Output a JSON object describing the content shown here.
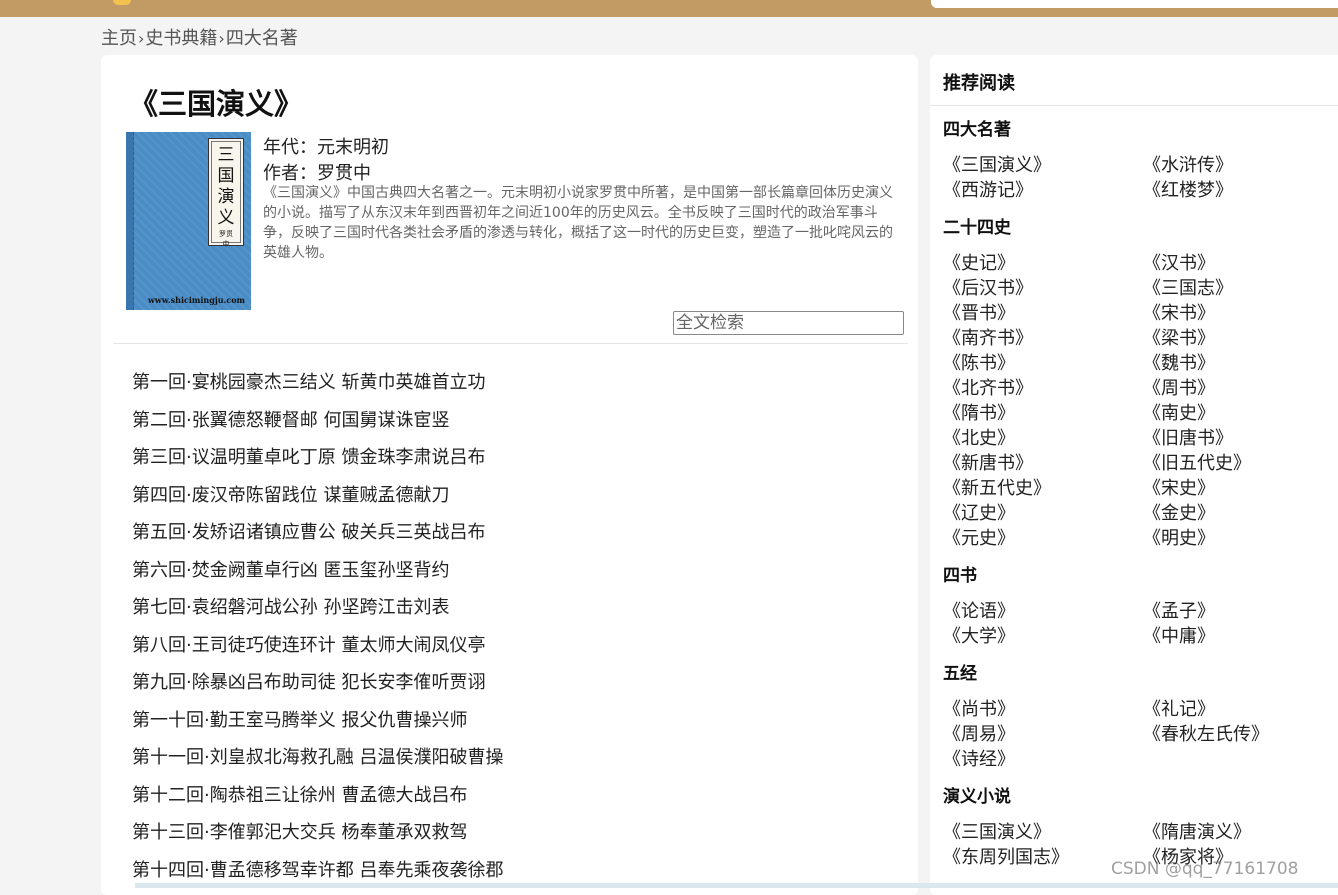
{
  "breadcrumb": {
    "home": "主页",
    "category": "史书典籍",
    "current": "四大名著",
    "separator": "›"
  },
  "book": {
    "title": "《三国演义》",
    "era_label": "年代：",
    "era": "元末明初",
    "author_label": "作者：",
    "author": "罗贯中",
    "description": "《三国演义》中国古典四大名著之一。元末明初小说家罗贯中所著，是中国第一部长篇章回体历史演义的小说。描写了从东汉末年到西晋初年之间近100年的历史风云。全书反映了三国时代的政治军事斗争，反映了三国时代各类社会矛盾的渗透与转化，概括了这一时代的历史巨变，塑造了一批叱咤风云的英雄人物。",
    "cover": {
      "title_vertical": "三国演义",
      "author_small": "罗贯中",
      "url": "www.shicimingju.com",
      "color": "#4a8dc6"
    }
  },
  "search": {
    "placeholder": "全文检索"
  },
  "chapters": [
    "第一回·宴桃园豪杰三结义 斩黄巾英雄首立功",
    "第二回·张翼德怒鞭督邮 何国舅谋诛宦竖",
    "第三回·议温明董卓叱丁原 馈金珠李肃说吕布",
    "第四回·废汉帝陈留践位 谋董贼孟德献刀",
    "第五回·发矫诏诸镇应曹公 破关兵三英战吕布",
    "第六回·焚金阙董卓行凶 匿玉玺孙坚背约",
    "第七回·袁绍磐河战公孙 孙坚跨江击刘表",
    "第八回·王司徒巧使连环计 董太师大闹凤仪亭",
    "第九回·除暴凶吕布助司徒 犯长安李傕听贾诩",
    "第一十回·勤王室马腾举义 报父仇曹操兴师",
    "第十一回·刘皇叔北海救孔融 吕温侯濮阳破曹操",
    "第十二回·陶恭祖三让徐州 曹孟德大战吕布",
    "第十三回·李傕郭汜大交兵 杨奉董承双救驾",
    "第十四回·曹孟德移驾幸许都 吕奉先乘夜袭徐郡"
  ],
  "sidebar": {
    "title": "推荐阅读",
    "sections": [
      {
        "heading": "四大名著",
        "items": [
          "《三国演义》",
          "《水浒传》",
          "《西游记》",
          "《红楼梦》"
        ]
      },
      {
        "heading": "二十四史",
        "items": [
          "《史记》",
          "《汉书》",
          "《后汉书》",
          "《三国志》",
          "《晋书》",
          "《宋书》",
          "《南齐书》",
          "《梁书》",
          "《陈书》",
          "《魏书》",
          "《北齐书》",
          "《周书》",
          "《隋书》",
          "《南史》",
          "《北史》",
          "《旧唐书》",
          "《新唐书》",
          "《旧五代史》",
          "《新五代史》",
          "《宋史》",
          "《辽史》",
          "《金史》",
          "《元史》",
          "《明史》"
        ]
      },
      {
        "heading": "四书",
        "items": [
          "《论语》",
          "《孟子》",
          "《大学》",
          "《中庸》"
        ]
      },
      {
        "heading": "五经",
        "items": [
          "《尚书》",
          "《礼记》",
          "《周易》",
          "《春秋左氏传》",
          "《诗经》"
        ]
      },
      {
        "heading": "演义小说",
        "items": [
          "《三国演义》",
          "《隋唐演义》",
          "《东周列国志》",
          "《杨家将》"
        ]
      }
    ]
  },
  "watermark": "CSDN @qq_77161708",
  "colors": {
    "topbar": "#c29a64",
    "page_bg": "#f4f4f4",
    "card_bg": "#ffffff"
  }
}
